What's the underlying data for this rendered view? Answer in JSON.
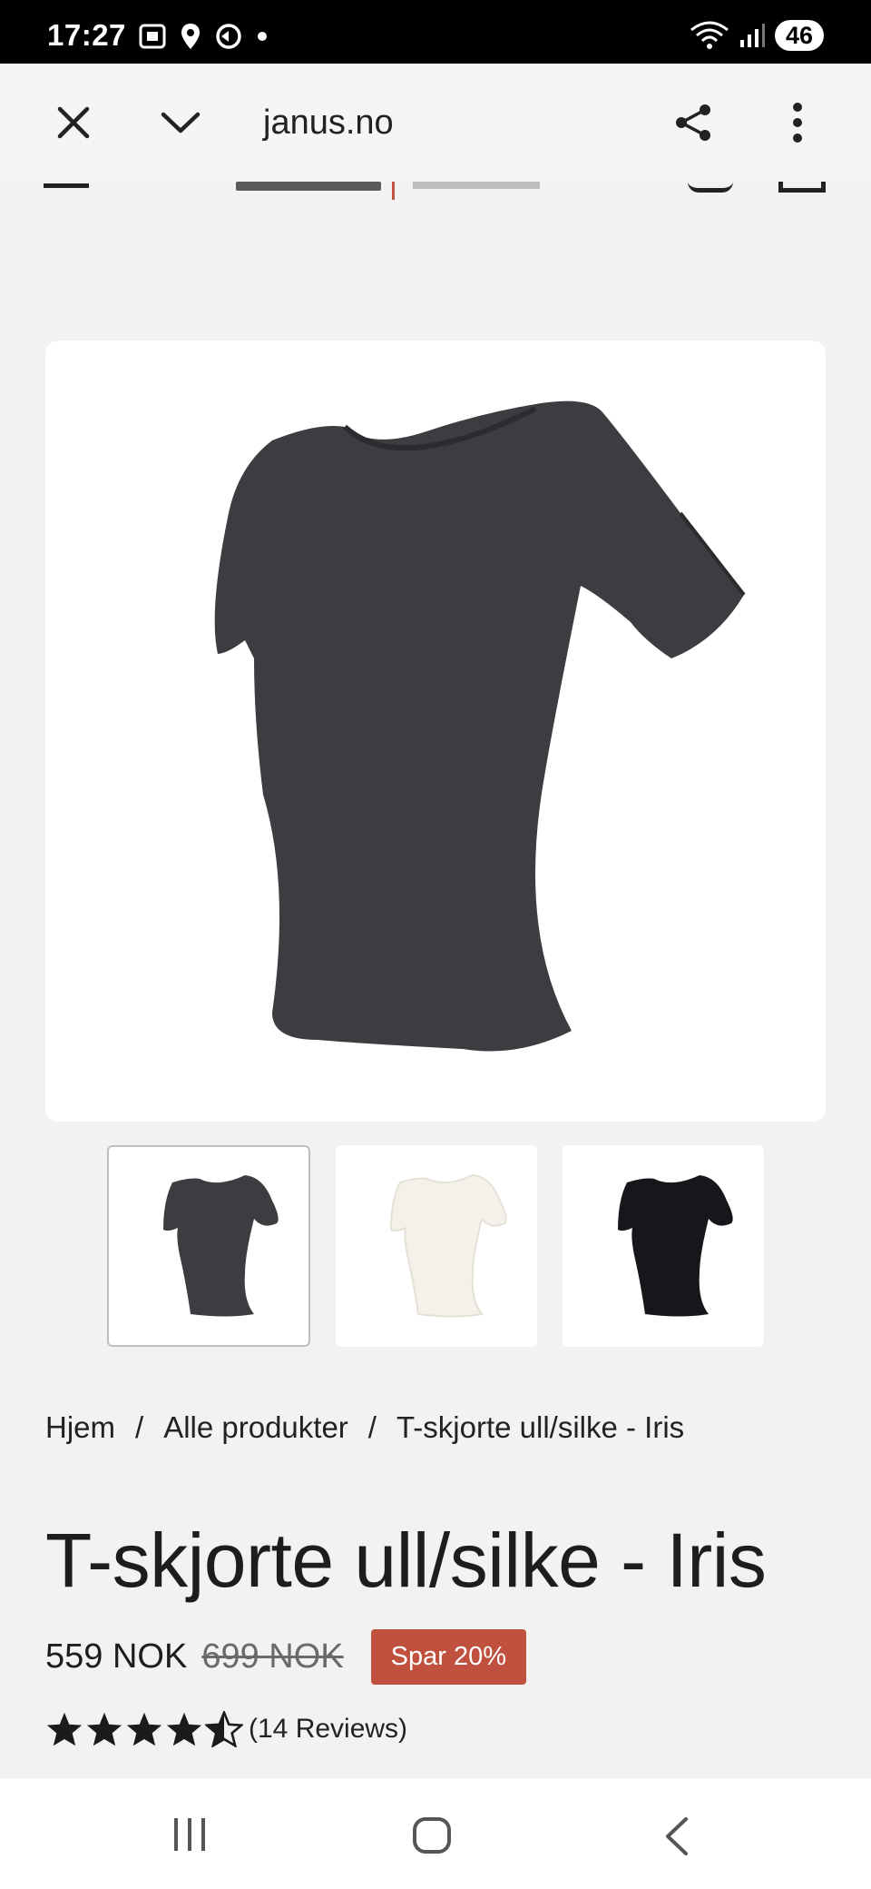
{
  "status_bar": {
    "time": "17:27",
    "battery": "46",
    "icons": [
      "screenshot-icon",
      "location-icon",
      "sync-icon",
      "dot-icon",
      "wifi-icon",
      "signal-icon"
    ]
  },
  "browser": {
    "url": "janus.no",
    "icons": [
      "close-icon",
      "chevron-down-icon",
      "share-icon",
      "more-vert-icon"
    ]
  },
  "product": {
    "breadcrumb": [
      "Hjem",
      "Alle produkter",
      "T-skjorte ull/silke - Iris"
    ],
    "breadcrumb_sep": "/",
    "title": "T-skjorte ull/silke - Iris",
    "price": "559 NOK",
    "old_price": "699 NOK",
    "discount_badge": "Spar 20%",
    "rating": 4.5,
    "reviews": "(14 Reviews)",
    "thumbnails": [
      {
        "color": "#3b3d40",
        "label": "grey"
      },
      {
        "color": "#f4f1ea",
        "label": "white"
      },
      {
        "color": "#16171a",
        "label": "black"
      }
    ],
    "main_color": "#3b3d40",
    "badge_color": "#c0513e"
  },
  "nav_bar": {
    "icons": [
      "recent-apps-icon",
      "home-icon",
      "back-icon"
    ]
  }
}
